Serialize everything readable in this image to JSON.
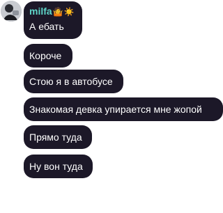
{
  "chat": {
    "sender_name": "milfa",
    "sender_emojis": [
      "🤷",
      "☀️"
    ],
    "messages": [
      "А ебать",
      "Короче",
      "Стою я в автобусе",
      "Знакомая девка упирается мне жопой",
      "Прямо туда",
      "Ну вон туда"
    ]
  },
  "colors": {
    "bubble_bg": "#1c1828",
    "sender_name": "#5fd6c9",
    "text": "#ffffff"
  }
}
